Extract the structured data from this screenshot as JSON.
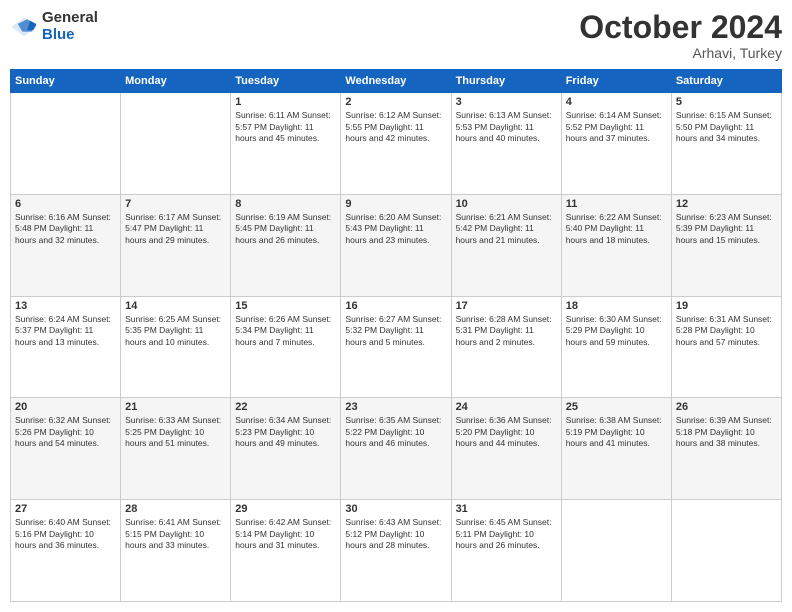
{
  "header": {
    "logo_general": "General",
    "logo_blue": "Blue",
    "month_title": "October 2024",
    "subtitle": "Arhavi, Turkey"
  },
  "weekdays": [
    "Sunday",
    "Monday",
    "Tuesday",
    "Wednesday",
    "Thursday",
    "Friday",
    "Saturday"
  ],
  "weeks": [
    [
      {
        "day": "",
        "content": ""
      },
      {
        "day": "",
        "content": ""
      },
      {
        "day": "1",
        "content": "Sunrise: 6:11 AM\nSunset: 5:57 PM\nDaylight: 11 hours and 45 minutes."
      },
      {
        "day": "2",
        "content": "Sunrise: 6:12 AM\nSunset: 5:55 PM\nDaylight: 11 hours and 42 minutes."
      },
      {
        "day": "3",
        "content": "Sunrise: 6:13 AM\nSunset: 5:53 PM\nDaylight: 11 hours and 40 minutes."
      },
      {
        "day": "4",
        "content": "Sunrise: 6:14 AM\nSunset: 5:52 PM\nDaylight: 11 hours and 37 minutes."
      },
      {
        "day": "5",
        "content": "Sunrise: 6:15 AM\nSunset: 5:50 PM\nDaylight: 11 hours and 34 minutes."
      }
    ],
    [
      {
        "day": "6",
        "content": "Sunrise: 6:16 AM\nSunset: 5:48 PM\nDaylight: 11 hours and 32 minutes."
      },
      {
        "day": "7",
        "content": "Sunrise: 6:17 AM\nSunset: 5:47 PM\nDaylight: 11 hours and 29 minutes."
      },
      {
        "day": "8",
        "content": "Sunrise: 6:19 AM\nSunset: 5:45 PM\nDaylight: 11 hours and 26 minutes."
      },
      {
        "day": "9",
        "content": "Sunrise: 6:20 AM\nSunset: 5:43 PM\nDaylight: 11 hours and 23 minutes."
      },
      {
        "day": "10",
        "content": "Sunrise: 6:21 AM\nSunset: 5:42 PM\nDaylight: 11 hours and 21 minutes."
      },
      {
        "day": "11",
        "content": "Sunrise: 6:22 AM\nSunset: 5:40 PM\nDaylight: 11 hours and 18 minutes."
      },
      {
        "day": "12",
        "content": "Sunrise: 6:23 AM\nSunset: 5:39 PM\nDaylight: 11 hours and 15 minutes."
      }
    ],
    [
      {
        "day": "13",
        "content": "Sunrise: 6:24 AM\nSunset: 5:37 PM\nDaylight: 11 hours and 13 minutes."
      },
      {
        "day": "14",
        "content": "Sunrise: 6:25 AM\nSunset: 5:35 PM\nDaylight: 11 hours and 10 minutes."
      },
      {
        "day": "15",
        "content": "Sunrise: 6:26 AM\nSunset: 5:34 PM\nDaylight: 11 hours and 7 minutes."
      },
      {
        "day": "16",
        "content": "Sunrise: 6:27 AM\nSunset: 5:32 PM\nDaylight: 11 hours and 5 minutes."
      },
      {
        "day": "17",
        "content": "Sunrise: 6:28 AM\nSunset: 5:31 PM\nDaylight: 11 hours and 2 minutes."
      },
      {
        "day": "18",
        "content": "Sunrise: 6:30 AM\nSunset: 5:29 PM\nDaylight: 10 hours and 59 minutes."
      },
      {
        "day": "19",
        "content": "Sunrise: 6:31 AM\nSunset: 5:28 PM\nDaylight: 10 hours and 57 minutes."
      }
    ],
    [
      {
        "day": "20",
        "content": "Sunrise: 6:32 AM\nSunset: 5:26 PM\nDaylight: 10 hours and 54 minutes."
      },
      {
        "day": "21",
        "content": "Sunrise: 6:33 AM\nSunset: 5:25 PM\nDaylight: 10 hours and 51 minutes."
      },
      {
        "day": "22",
        "content": "Sunrise: 6:34 AM\nSunset: 5:23 PM\nDaylight: 10 hours and 49 minutes."
      },
      {
        "day": "23",
        "content": "Sunrise: 6:35 AM\nSunset: 5:22 PM\nDaylight: 10 hours and 46 minutes."
      },
      {
        "day": "24",
        "content": "Sunrise: 6:36 AM\nSunset: 5:20 PM\nDaylight: 10 hours and 44 minutes."
      },
      {
        "day": "25",
        "content": "Sunrise: 6:38 AM\nSunset: 5:19 PM\nDaylight: 10 hours and 41 minutes."
      },
      {
        "day": "26",
        "content": "Sunrise: 6:39 AM\nSunset: 5:18 PM\nDaylight: 10 hours and 38 minutes."
      }
    ],
    [
      {
        "day": "27",
        "content": "Sunrise: 6:40 AM\nSunset: 5:16 PM\nDaylight: 10 hours and 36 minutes."
      },
      {
        "day": "28",
        "content": "Sunrise: 6:41 AM\nSunset: 5:15 PM\nDaylight: 10 hours and 33 minutes."
      },
      {
        "day": "29",
        "content": "Sunrise: 6:42 AM\nSunset: 5:14 PM\nDaylight: 10 hours and 31 minutes."
      },
      {
        "day": "30",
        "content": "Sunrise: 6:43 AM\nSunset: 5:12 PM\nDaylight: 10 hours and 28 minutes."
      },
      {
        "day": "31",
        "content": "Sunrise: 6:45 AM\nSunset: 5:11 PM\nDaylight: 10 hours and 26 minutes."
      },
      {
        "day": "",
        "content": ""
      },
      {
        "day": "",
        "content": ""
      }
    ]
  ]
}
